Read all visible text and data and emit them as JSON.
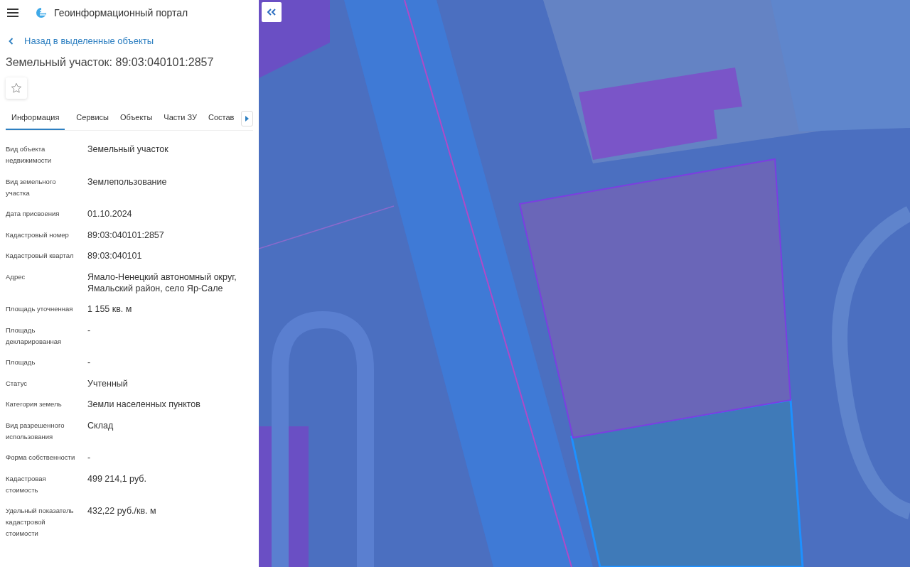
{
  "header": {
    "title": "Геоинформационный портал"
  },
  "back_link": "Назад в выделенные объекты",
  "object_title": "Земельный участок: 89:03:040101:2857",
  "favorite": {
    "on": false
  },
  "tabs": [
    {
      "label": "Информация",
      "selected": true
    },
    {
      "label": "Сервисы",
      "selected": false
    },
    {
      "label": "Объекты",
      "selected": false
    },
    {
      "label": "Части ЗУ",
      "selected": false
    },
    {
      "label": "Состав",
      "selected": false
    }
  ],
  "properties": [
    {
      "label": "Вид объекта недвижимости",
      "value": "Земельный участок"
    },
    {
      "label": "Вид земельного участка",
      "value": "Землепользование"
    },
    {
      "label": "Дата присвоения",
      "value": "01.10.2024"
    },
    {
      "label": "Кадастровый номер",
      "value": "89:03:040101:2857"
    },
    {
      "label": "Кадастровый квартал",
      "value": "89:03:040101"
    },
    {
      "label": "Адрес",
      "value": "Ямало-Ненецкий автономный округ, Ямальский район, село Яр-Сале"
    },
    {
      "label": "Площадь уточненная",
      "value": "1 155 кв. м"
    },
    {
      "label": "Площадь декларированная",
      "value": "-"
    },
    {
      "label": "Площадь",
      "value": "-"
    },
    {
      "label": "Статус",
      "value": "Учтенный"
    },
    {
      "label": "Категория земель",
      "value": "Земли населенных пунктов"
    },
    {
      "label": "Вид разрешенного использования",
      "value": "Склад"
    },
    {
      "label": "Форма собственности",
      "value": "-"
    },
    {
      "label": "Кадастровая стоимость",
      "value": "499 214,1 руб."
    },
    {
      "label": "Удельный показатель кадастровой стоимости",
      "value": "432,22 руб./кв. м"
    }
  ]
}
